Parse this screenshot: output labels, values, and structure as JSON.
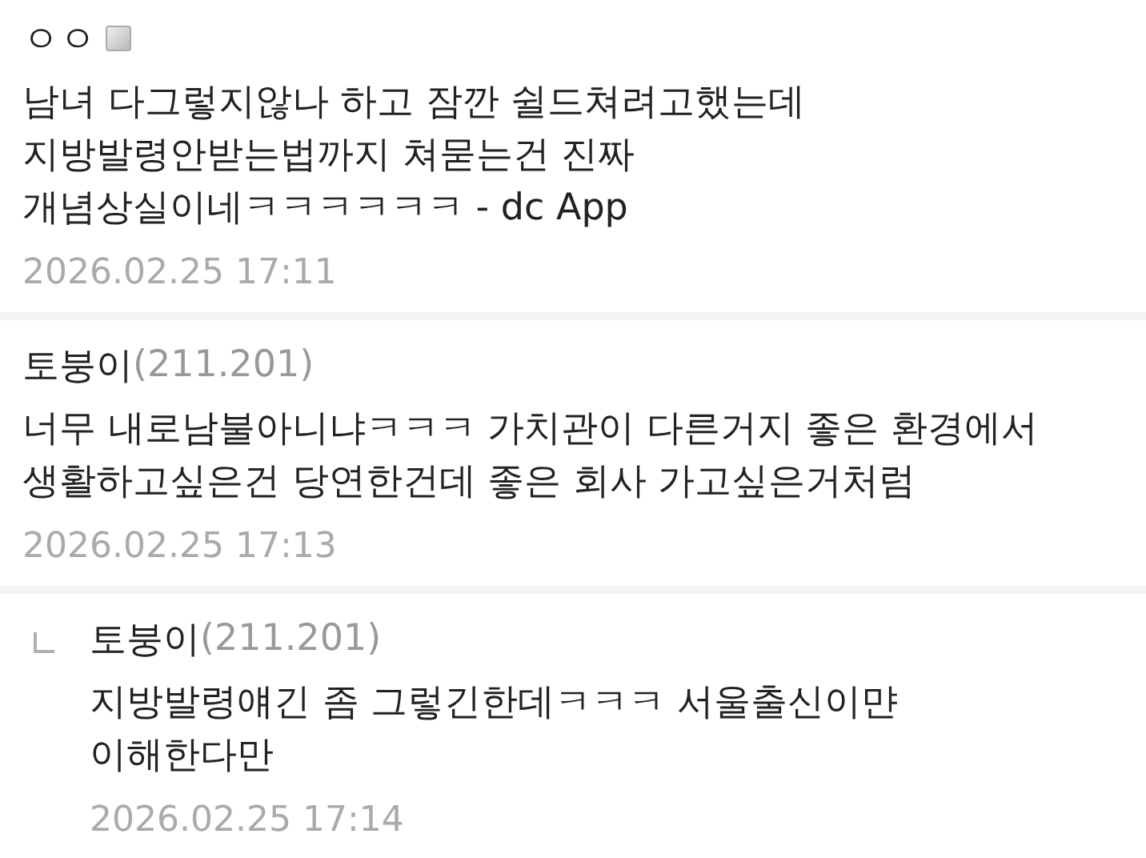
{
  "comments": [
    {
      "kind": "comment",
      "author": "ㅇㅇ",
      "has_badge": true,
      "text": "남녀 다그렇지않나 하고 잠깐 쉴드쳐려고했는데\n지방발령안받는법까지 쳐묻는건 진짜\n개념상실이네ㅋㅋㅋㅋㅋㅋ - dc App",
      "date": "2026.02.25 17:11"
    },
    {
      "kind": "comment",
      "author": "토붕이",
      "ip": "(211.201)",
      "has_badge": false,
      "text": "너무 내로남불아니냐ㅋㅋㅋ 가치관이 다른거지 좋은 환경에서\n생활하고싶은건 당연한건데 좋은 회사 가고싶은거처럼",
      "date": "2026.02.25 17:13"
    },
    {
      "kind": "reply",
      "author": "토붕이",
      "ip": "(211.201)",
      "has_badge": false,
      "text": "지방발령얘긴 좀 그렇긴한데ㅋㅋㅋ 서울출신이먄\n이해한다만",
      "date": "2026.02.25 17:14"
    }
  ]
}
